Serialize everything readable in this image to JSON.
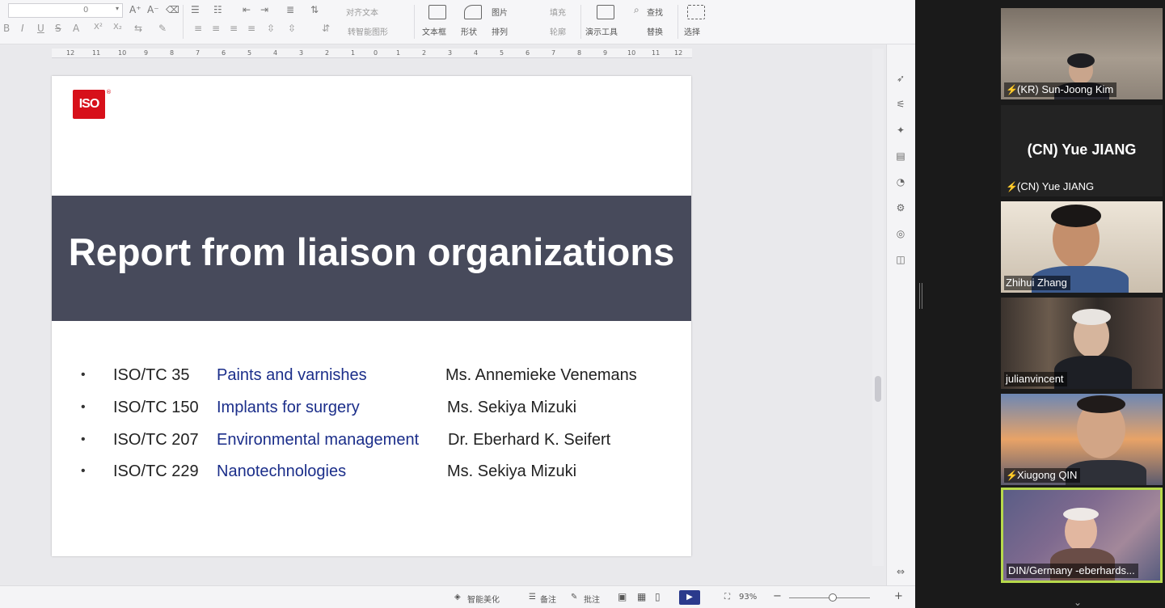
{
  "toolbar": {
    "font_size_value": "0",
    "glyphs_row1": [
      "A⁺",
      "A⁻",
      "⌫",
      "☰",
      "☷",
      "⇤",
      "⇥",
      "≣",
      "⇅"
    ],
    "glyphs_row2": [
      "B",
      "I",
      "U",
      "S",
      "A",
      "X²",
      "X₂",
      "⇆",
      "✎",
      "≡",
      "≡",
      "≡",
      "≡",
      "⇳",
      "⇳",
      "⇵"
    ],
    "align_text": "对齐文本",
    "smart_art": "转智能图形",
    "textbox": "文本框",
    "shape": "形状",
    "picture": "图片",
    "fill": "填充",
    "arrange": "排列",
    "outline": "轮廓",
    "present_tools": "演示工具",
    "find": "查找",
    "replace": "替换",
    "select": "选择"
  },
  "ruler": {
    "ticks": [
      "12",
      "11",
      "10",
      "9",
      "8",
      "7",
      "6",
      "5",
      "4",
      "3",
      "2",
      "1",
      "0",
      "1",
      "2",
      "3",
      "4",
      "5",
      "6",
      "7",
      "8",
      "9",
      "10",
      "11",
      "12"
    ]
  },
  "slide": {
    "logo_text": "ISO",
    "logo_mark": "®",
    "title": "Report from liaison organizations",
    "bullet": "•",
    "rows": [
      {
        "tc": "ISO/TC 35",
        "topic": "Paints and varnishes",
        "person": "Ms. Annemieke Venemans"
      },
      {
        "tc": "ISO/TC 150",
        "topic": "Implants for surgery",
        "person": "Ms. Sekiya Mizuki"
      },
      {
        "tc": "ISO/TC 207",
        "topic": "Environmental management",
        "person": "Dr. Eberhard K. Seifert"
      },
      {
        "tc": "ISO/TC 229",
        "topic": "Nanotechnologies",
        "person": "Ms. Sekiya Mizuki"
      }
    ]
  },
  "statusbar": {
    "smart_beautify": "智能美化",
    "notes": "备注",
    "comments": "批注",
    "zoom": "93%",
    "minus": "−",
    "plus": "+",
    "play": "▶"
  },
  "participants": [
    {
      "name": "(KR) Sun-Joong Kim",
      "muted": true
    },
    {
      "name": "(CN) Yue JIANG",
      "muted": true,
      "big_name": "(CN) Yue JIANG"
    },
    {
      "name": "Zhihui Zhang",
      "muted": false
    },
    {
      "name": "julianvincent",
      "muted": false
    },
    {
      "name": "Xiugong QIN",
      "muted": true
    },
    {
      "name": "DIN/Germany -eberhards...",
      "muted": false
    }
  ],
  "colors": {
    "title_band": "#474a5b",
    "topic_text": "#1b2e8a",
    "iso_red": "#d7101a",
    "active_speaker": "#b7d94b",
    "muted_icon": "#e0312f"
  }
}
